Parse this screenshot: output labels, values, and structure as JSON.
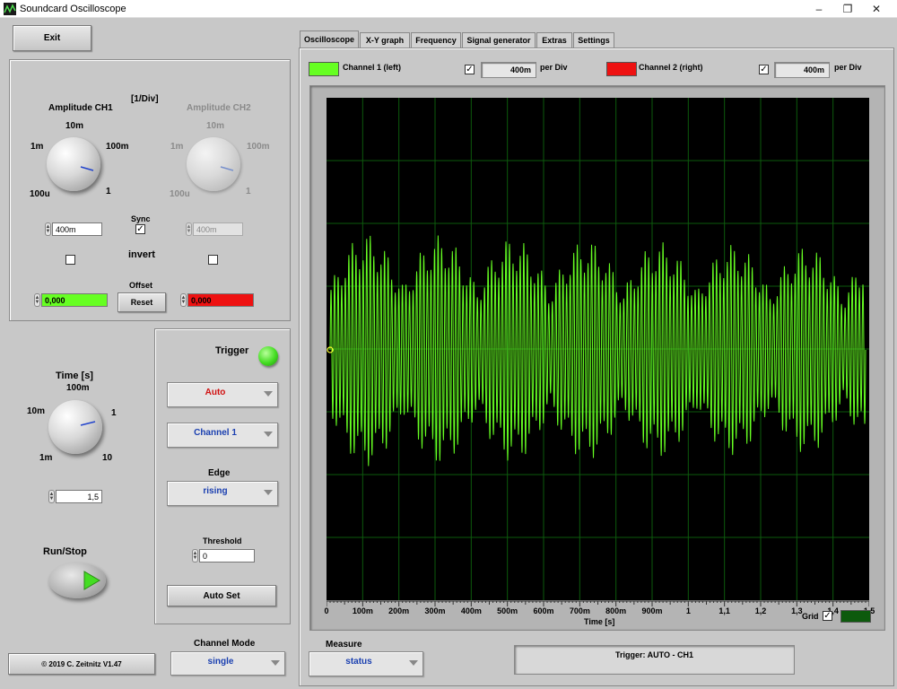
{
  "window": {
    "title": "Soundcard Oscilloscope",
    "controls": [
      "–",
      "❐",
      "✕"
    ]
  },
  "left": {
    "exit_label": "Exit",
    "div_unit": "[1/Div]",
    "amp_ch1": {
      "title": "Amplitude CH1",
      "ticks": [
        "10m",
        "1m",
        "100m",
        "100u",
        "1"
      ],
      "value": "400m"
    },
    "amp_ch2": {
      "title": "Amplitude CH2",
      "ticks": [
        "10m",
        "1m",
        "100m",
        "100u",
        "1"
      ],
      "value": "400m"
    },
    "sync_label": "Sync",
    "sync_checked": true,
    "invert_label": "invert",
    "offset_label": "Offset",
    "offset_ch1": "0,000",
    "offset_ch2": "0,000",
    "reset_label": "Reset",
    "time": {
      "title": "Time [s]",
      "ticks": [
        "100m",
        "10m",
        "1",
        "1m",
        "10"
      ],
      "value": "1,5"
    },
    "runstop_label": "Run/Stop",
    "copyright": "© 2019  C. Zeitnitz V1.47",
    "channel_mode_label": "Channel Mode",
    "channel_mode_value": "single"
  },
  "trigger": {
    "title": "Trigger",
    "mode": "Auto",
    "channel": "Channel 1",
    "edge_label": "Edge",
    "edge": "rising",
    "threshold_label": "Threshold",
    "threshold_value": "0",
    "autoset_label": "Auto Set"
  },
  "tabs": [
    "Oscilloscope",
    "X-Y graph",
    "Frequency",
    "Signal generator",
    "Extras",
    "Settings"
  ],
  "scope": {
    "ch1_label": "Channel 1 (left)",
    "ch1_color": "#66ff22",
    "ch1_enabled": true,
    "ch1_perdiv": "400m",
    "ch2_label": "Channel 2 (right)",
    "ch2_color": "#ee1111",
    "ch2_enabled": true,
    "ch2_perdiv": "400m",
    "per_div_label": "per Div",
    "x_ticks": [
      "0",
      "100m",
      "200m",
      "300m",
      "400m",
      "500m",
      "600m",
      "700m",
      "800m",
      "900m",
      "1",
      "1,1",
      "1,2",
      "1,3",
      "1,4",
      "1,5"
    ],
    "x_axis_label": "Time [s]",
    "grid_label": "Grid",
    "grid_checked": true,
    "grid_color": "#0d5a0d",
    "measure_label": "Measure",
    "measure_value": "status",
    "trigger_status": "Trigger: AUTO - CH1"
  },
  "chart_data": {
    "type": "line",
    "xlabel": "Time [s]",
    "xlim": [
      0,
      1.5
    ],
    "series": [
      {
        "name": "Channel 1 (left)",
        "color": "#66ff22",
        "envelope_max": [
          0.75,
          0.65
        ],
        "envelope_min": [
          -0.75,
          -0.65
        ]
      }
    ]
  }
}
